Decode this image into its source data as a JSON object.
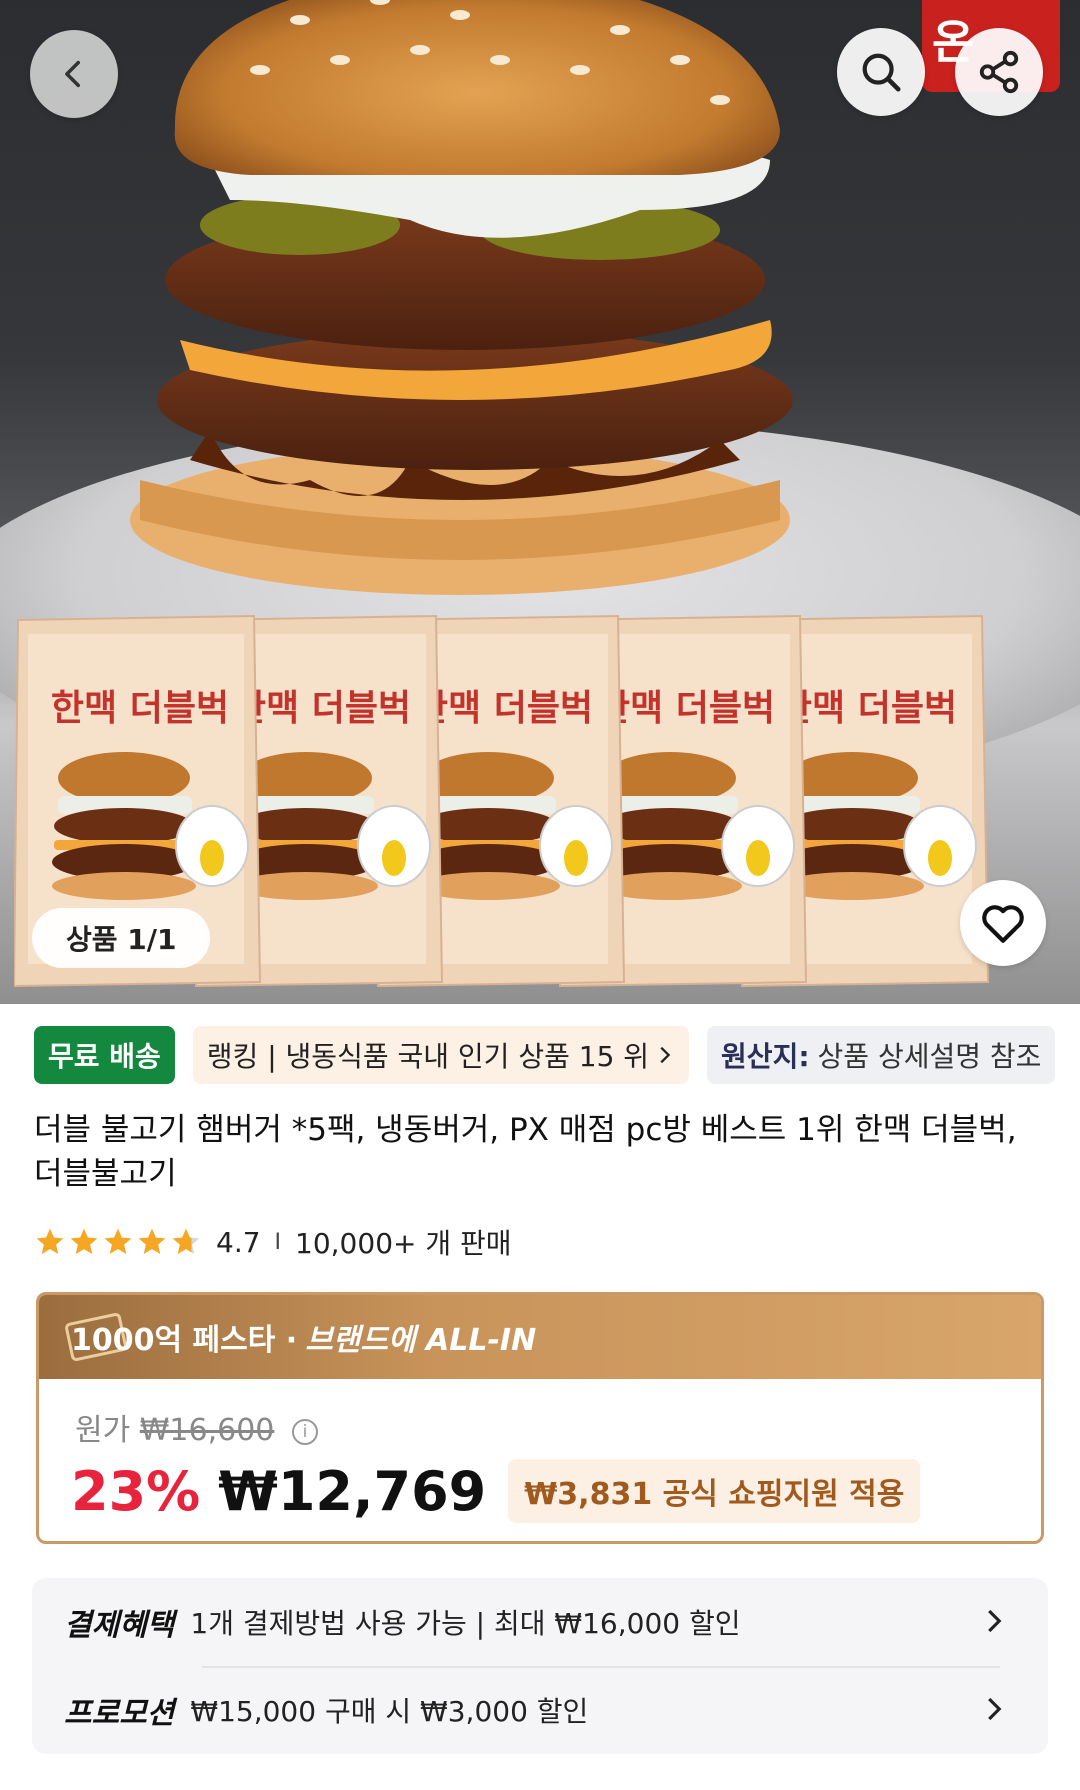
{
  "hero": {
    "logo_text": "온",
    "counter": "상품 1/1"
  },
  "chips": {
    "free_delivery": "무료 배송",
    "ranking": "랭킹 | 냉동식품 국내 인기 상품 15 위",
    "origin_label": "원산지:",
    "origin_value": "상품 상세설명 참조"
  },
  "product": {
    "title": "더블 불고기 햄버거 *5팩, 냉동버거, PX 매점 pc방 베스트 1위 한맥 더블벅, 더블불고기",
    "rating": "4.7",
    "sales": "10,000+ 개 판매",
    "stars": 4.7,
    "package_text": "한맥 더블벅"
  },
  "promo": {
    "banner_prefix": "1000억 페스타 · ",
    "banner_brand": "브랜드에 ALL-IN",
    "original_label": "원가",
    "original_price": "₩16,600",
    "discount": "23%",
    "price": "₩12,769",
    "support": "₩3,831 공식 쇼핑지원 적용"
  },
  "benefits": {
    "payment_label": "결제혜택",
    "payment_text": "1개 결제방법 사용 가능 | 최대 ₩16,000 할인",
    "promotion_label": "프로모션",
    "promotion_text": "₩15,000 구매 시 ₩3,000 할인"
  },
  "colors": {
    "free_delivery": "#14883e",
    "discount": "#e8233c",
    "promo_border": "#c99a66",
    "brand_red": "#c9211e"
  }
}
